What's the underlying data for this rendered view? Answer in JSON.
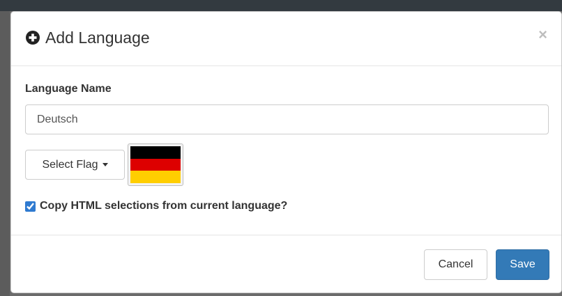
{
  "modal": {
    "title": "Add Language",
    "title_icon": "plus-circle-icon",
    "close_symbol": "×",
    "close_icon": "close-icon"
  },
  "form": {
    "language_name_label": "Language Name",
    "language_name_value": "Deutsch",
    "select_flag_label": "Select Flag",
    "selected_flag": {
      "country": "Germany",
      "stripe_colors": [
        "#000000",
        "#dd0000",
        "#ffce00"
      ]
    },
    "copy_html_label": "Copy HTML selections from current language?",
    "copy_html_checked": true
  },
  "footer": {
    "cancel_label": "Cancel",
    "save_label": "Save"
  },
  "colors": {
    "primary": "#337ab7",
    "overlay": "#6b6b6b",
    "checkbox_accent": "#2f7ad0"
  }
}
